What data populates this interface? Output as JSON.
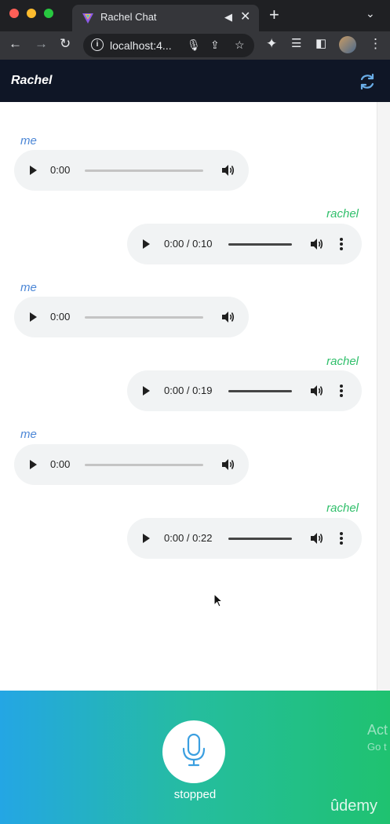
{
  "browser": {
    "tab_title": "Rachel Chat",
    "url": "localhost:4...",
    "tab_close": "✕",
    "new_tab": "+",
    "tab_menu": "⌄"
  },
  "app": {
    "brand": "Rachel"
  },
  "messages": [
    {
      "sender": "me",
      "time": "0:00",
      "progress": 0
    },
    {
      "sender": "rachel",
      "time": "0:00 / 0:10",
      "progress": 0
    },
    {
      "sender": "me",
      "time": "0:00",
      "progress": 0
    },
    {
      "sender": "rachel",
      "time": "0:00 / 0:19",
      "progress": 0
    },
    {
      "sender": "me",
      "time": "0:00",
      "progress": 0
    },
    {
      "sender": "rachel",
      "time": "0:00 / 0:22",
      "progress": 0
    }
  ],
  "recorder": {
    "status": "stopped"
  },
  "watermark": {
    "activate": "Act",
    "goto": "Go t",
    "udemy": "ûdemy"
  },
  "colors": {
    "me": "#4b86d6",
    "rachel": "#2fbf6a",
    "gradient_start": "#24a6e4",
    "gradient_end": "#1fc270"
  }
}
